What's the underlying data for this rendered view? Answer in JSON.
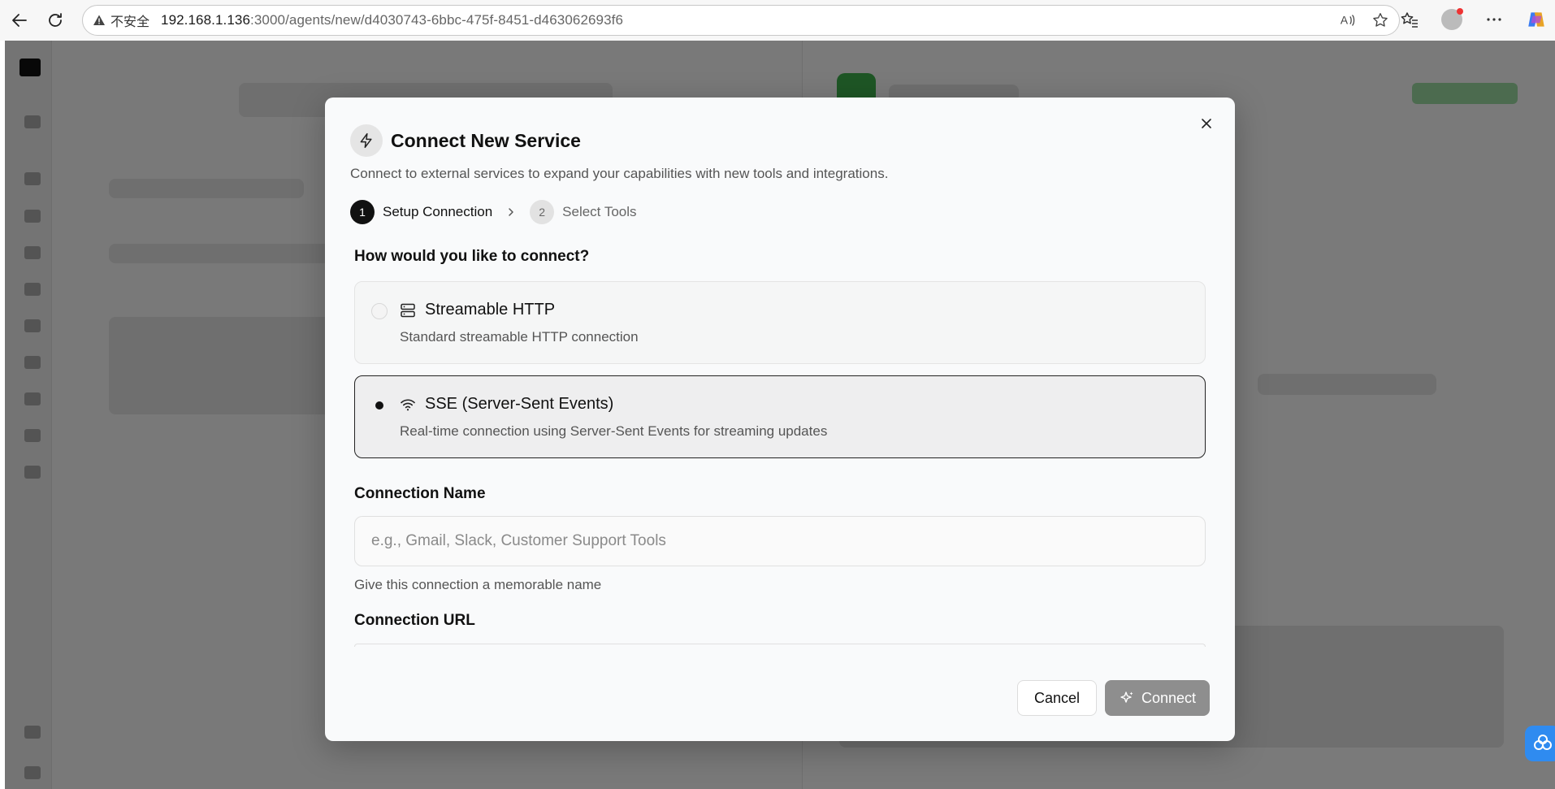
{
  "browser": {
    "insecure_label": "不安全",
    "url_host": "192.168.1.136",
    "url_path": ":3000/agents/new/d4030743-6bbc-475f-8451-d463062693f6"
  },
  "modal": {
    "title": "Connect New Service",
    "description": "Connect to external services to expand your capabilities with new tools and integrations.",
    "steps": [
      {
        "number": "1",
        "label": "Setup Connection",
        "active": true
      },
      {
        "number": "2",
        "label": "Select Tools",
        "active": false
      }
    ],
    "question": "How would you like to connect?",
    "options": [
      {
        "title": "Streamable HTTP",
        "description": "Standard streamable HTTP connection",
        "icon": "server-icon",
        "selected": false
      },
      {
        "title": "SSE (Server-Sent Events)",
        "description": "Real-time connection using Server-Sent Events for streaming updates",
        "icon": "wifi-icon",
        "selected": true
      }
    ],
    "connection_name": {
      "label": "Connection Name",
      "value": "",
      "placeholder": "e.g., Gmail, Slack, Customer Support Tools",
      "helper": "Give this connection a memorable name"
    },
    "connection_url": {
      "label": "Connection URL"
    },
    "cancel_label": "Cancel",
    "connect_label": "Connect"
  },
  "colors": {
    "primary": "#111111",
    "connect_disabled": "#8e8e8e",
    "overlay": "rgba(0,0,0,0.52)"
  }
}
